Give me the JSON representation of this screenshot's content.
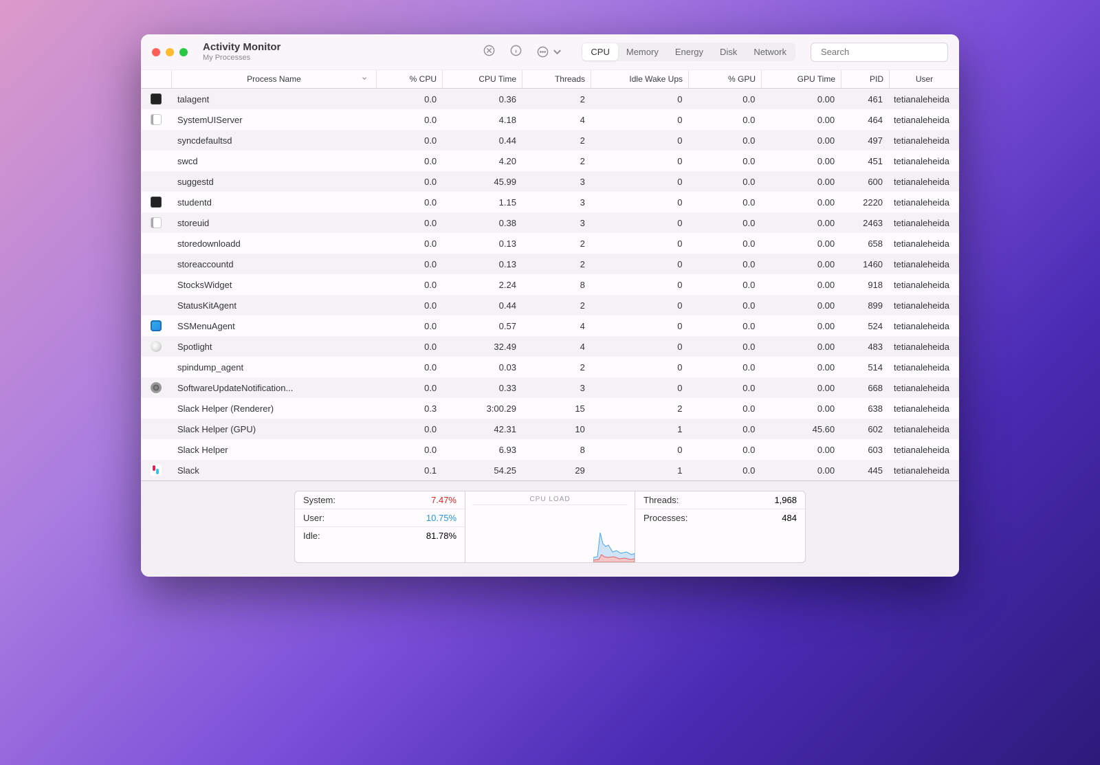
{
  "header": {
    "title": "Activity Monitor",
    "subtitle": "My Processes"
  },
  "search": {
    "placeholder": "Search"
  },
  "tabs": [
    {
      "label": "CPU",
      "active": true
    },
    {
      "label": "Memory",
      "active": false
    },
    {
      "label": "Energy",
      "active": false
    },
    {
      "label": "Disk",
      "active": false
    },
    {
      "label": "Network",
      "active": false
    }
  ],
  "columns": {
    "name": "Process Name",
    "cpu": "% CPU",
    "time": "CPU Time",
    "threads": "Threads",
    "wake": "Idle Wake Ups",
    "gpu": "% GPU",
    "gtime": "GPU Time",
    "pid": "PID",
    "user": "User"
  },
  "rows": [
    {
      "icon": "terminal",
      "name": "talagent",
      "cpu": "0.0",
      "time": "0.36",
      "threads": "2",
      "wake": "0",
      "gpu": "0.0",
      "gtime": "0.00",
      "pid": "461",
      "user": "tetianaleheida"
    },
    {
      "icon": "finder",
      "name": "SystemUIServer",
      "cpu": "0.0",
      "time": "4.18",
      "threads": "4",
      "wake": "0",
      "gpu": "0.0",
      "gtime": "0.00",
      "pid": "464",
      "user": "tetianaleheida"
    },
    {
      "icon": "",
      "name": "syncdefaultsd",
      "cpu": "0.0",
      "time": "0.44",
      "threads": "2",
      "wake": "0",
      "gpu": "0.0",
      "gtime": "0.00",
      "pid": "497",
      "user": "tetianaleheida"
    },
    {
      "icon": "",
      "name": "swcd",
      "cpu": "0.0",
      "time": "4.20",
      "threads": "2",
      "wake": "0",
      "gpu": "0.0",
      "gtime": "0.00",
      "pid": "451",
      "user": "tetianaleheida"
    },
    {
      "icon": "",
      "name": "suggestd",
      "cpu": "0.0",
      "time": "45.99",
      "threads": "3",
      "wake": "0",
      "gpu": "0.0",
      "gtime": "0.00",
      "pid": "600",
      "user": "tetianaleheida"
    },
    {
      "icon": "terminal",
      "name": "studentd",
      "cpu": "0.0",
      "time": "1.15",
      "threads": "3",
      "wake": "0",
      "gpu": "0.0",
      "gtime": "0.00",
      "pid": "2220",
      "user": "tetianaleheida"
    },
    {
      "icon": "finder",
      "name": "storeuid",
      "cpu": "0.0",
      "time": "0.38",
      "threads": "3",
      "wake": "0",
      "gpu": "0.0",
      "gtime": "0.00",
      "pid": "2463",
      "user": "tetianaleheida"
    },
    {
      "icon": "",
      "name": "storedownloadd",
      "cpu": "0.0",
      "time": "0.13",
      "threads": "2",
      "wake": "0",
      "gpu": "0.0",
      "gtime": "0.00",
      "pid": "658",
      "user": "tetianaleheida"
    },
    {
      "icon": "",
      "name": "storeaccountd",
      "cpu": "0.0",
      "time": "0.13",
      "threads": "2",
      "wake": "0",
      "gpu": "0.0",
      "gtime": "0.00",
      "pid": "1460",
      "user": "tetianaleheida"
    },
    {
      "icon": "",
      "name": "StocksWidget",
      "cpu": "0.0",
      "time": "2.24",
      "threads": "8",
      "wake": "0",
      "gpu": "0.0",
      "gtime": "0.00",
      "pid": "918",
      "user": "tetianaleheida"
    },
    {
      "icon": "",
      "name": "StatusKitAgent",
      "cpu": "0.0",
      "time": "0.44",
      "threads": "2",
      "wake": "0",
      "gpu": "0.0",
      "gtime": "0.00",
      "pid": "899",
      "user": "tetianaleheida"
    },
    {
      "icon": "ssmenu",
      "name": "SSMenuAgent",
      "cpu": "0.0",
      "time": "0.57",
      "threads": "4",
      "wake": "0",
      "gpu": "0.0",
      "gtime": "0.00",
      "pid": "524",
      "user": "tetianaleheida"
    },
    {
      "icon": "spotlight",
      "name": "Spotlight",
      "cpu": "0.0",
      "time": "32.49",
      "threads": "4",
      "wake": "0",
      "gpu": "0.0",
      "gtime": "0.00",
      "pid": "483",
      "user": "tetianaleheida"
    },
    {
      "icon": "",
      "name": "spindump_agent",
      "cpu": "0.0",
      "time": "0.03",
      "threads": "2",
      "wake": "0",
      "gpu": "0.0",
      "gtime": "0.00",
      "pid": "514",
      "user": "tetianaleheida"
    },
    {
      "icon": "settings",
      "name": "SoftwareUpdateNotification...",
      "cpu": "0.0",
      "time": "0.33",
      "threads": "3",
      "wake": "0",
      "gpu": "0.0",
      "gtime": "0.00",
      "pid": "668",
      "user": "tetianaleheida"
    },
    {
      "icon": "",
      "name": "Slack Helper (Renderer)",
      "cpu": "0.3",
      "time": "3:00.29",
      "threads": "15",
      "wake": "2",
      "gpu": "0.0",
      "gtime": "0.00",
      "pid": "638",
      "user": "tetianaleheida"
    },
    {
      "icon": "",
      "name": "Slack Helper (GPU)",
      "cpu": "0.0",
      "time": "42.31",
      "threads": "10",
      "wake": "1",
      "gpu": "0.0",
      "gtime": "45.60",
      "pid": "602",
      "user": "tetianaleheida"
    },
    {
      "icon": "",
      "name": "Slack Helper",
      "cpu": "0.0",
      "time": "6.93",
      "threads": "8",
      "wake": "0",
      "gpu": "0.0",
      "gtime": "0.00",
      "pid": "603",
      "user": "tetianaleheida"
    },
    {
      "icon": "slack",
      "name": "Slack",
      "cpu": "0.1",
      "time": "54.25",
      "threads": "29",
      "wake": "1",
      "gpu": "0.0",
      "gtime": "0.00",
      "pid": "445",
      "user": "tetianaleheida"
    }
  ],
  "footer": {
    "system_label": "System:",
    "system_val": "7.47%",
    "user_label": "User:",
    "user_val": "10.75%",
    "idle_label": "Idle:",
    "idle_val": "81.78%",
    "cpu_load_label": "CPU LOAD",
    "threads_label": "Threads:",
    "threads_val": "1,968",
    "processes_label": "Processes:",
    "processes_val": "484"
  }
}
